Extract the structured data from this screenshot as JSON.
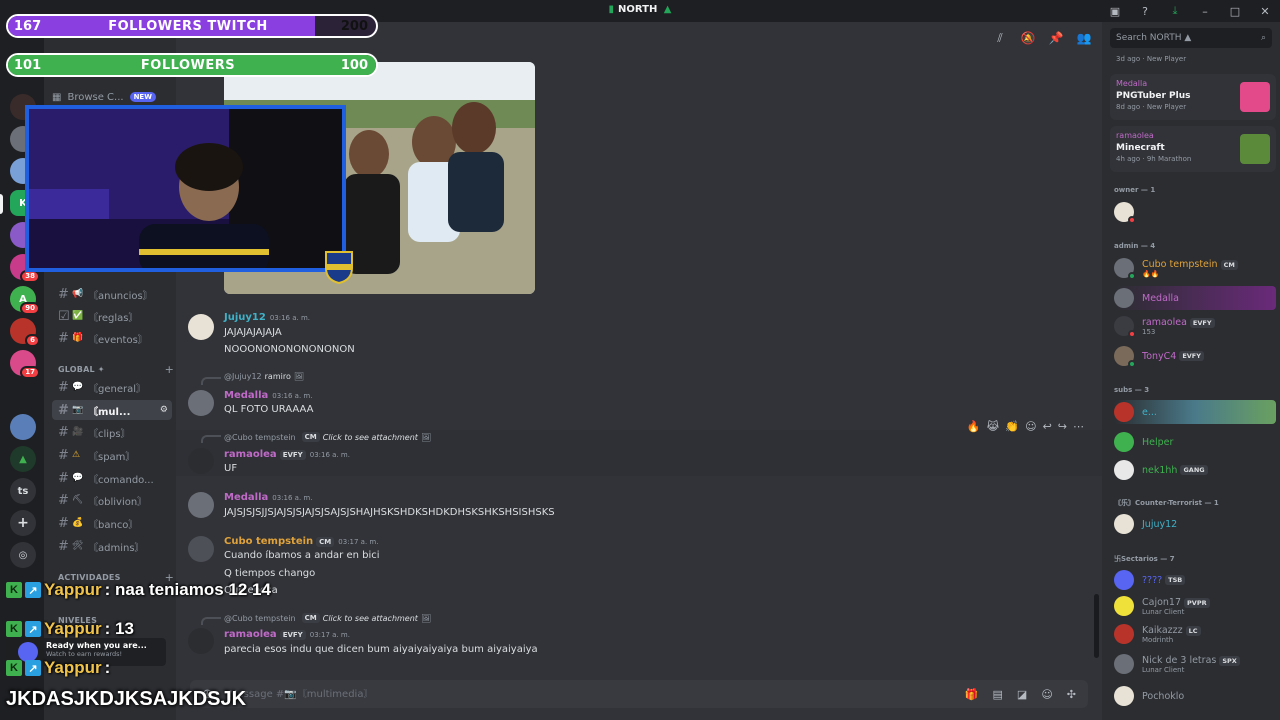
{
  "window": {
    "server_title": "NORTH",
    "server_emoji": "▲"
  },
  "overlays": {
    "twitch_bar": {
      "current": "167",
      "label": "FOLLOWERS TWITCH",
      "goal": "200",
      "progress": 0.835,
      "color": "#8a3fe0"
    },
    "followers_bar": {
      "current": "101",
      "label": "FOLLOWERS",
      "goal": "100",
      "progress": 1.0,
      "color": "#3fb24f"
    },
    "chat": [
      {
        "user": "Yappur",
        "text": ": naa teniamos 12 14"
      },
      {
        "user": "Yappur",
        "text": ": 13"
      },
      {
        "user": "Yappur",
        "text": ":"
      }
    ],
    "bottom_text": "JKDASJKDJKSAJKDSJK",
    "promo": {
      "title": "Ready when you are...",
      "subtitle": "Watch to earn rewards!"
    }
  },
  "rail": {
    "servers": [
      {
        "badge": ""
      },
      {
        "badge": ""
      },
      {
        "badge": ""
      },
      {
        "badge": ""
      },
      {
        "badge": ""
      },
      {
        "badge": ""
      },
      {
        "badge": "38"
      },
      {
        "badge": "90"
      },
      {
        "badge": "6"
      },
      {
        "badge": "17"
      },
      {
        "badge": ""
      },
      {
        "badge": ""
      }
    ],
    "ts_label": "ts"
  },
  "sidebar": {
    "browse": "Browse C...",
    "browse_badge": "NEW",
    "channels_top": [
      {
        "icon": "📢",
        "name": "〘anuncios〙"
      },
      {
        "icon": "✅",
        "name": "〘reglas〙"
      },
      {
        "icon": "🎁",
        "name": "〘eventos〙"
      }
    ],
    "category_global": "GLOBAL ✦",
    "channels_global": [
      {
        "icon": "💬",
        "name": "〘general〙",
        "active": false
      },
      {
        "icon": "📷",
        "name": "〘mul...",
        "active": true
      },
      {
        "icon": "🎥",
        "name": "〘clips〙",
        "active": false
      },
      {
        "icon": "⚠",
        "name": "〘spam〙",
        "active": false
      },
      {
        "icon": "💬",
        "name": "〘comando...",
        "active": false
      },
      {
        "icon": "⛏",
        "name": "〘oblivion〙",
        "active": false
      },
      {
        "icon": "💰",
        "name": "〘banco〙",
        "active": false
      },
      {
        "icon": "🛠",
        "name": "〘admins〙",
        "active": false
      }
    ],
    "category_actividades": "ACTIVIDADES",
    "category_niveles": "NIVELES"
  },
  "chat": {
    "messages": [
      {
        "user": "Jujuy12",
        "color": "#3fb2c8",
        "time": "03:16 a. m.",
        "lines": [
          "JAJAJAJAJAJA",
          "NOOONONONONONONON"
        ]
      },
      {
        "reply_user": "@Jujuy12",
        "reply_text": "ramiro",
        "user": "Medalla",
        "color": "#c06ac8",
        "time": "03:16 a. m.",
        "lines": [
          "QL FOTO URAAAA"
        ]
      },
      {
        "reply_user": "@Cubo tempstein",
        "reply_tag": "CM",
        "reply_text": "Click to see attachment",
        "user": "ramaolea",
        "color": "#c06ac8",
        "tag": "EVFY",
        "time": "03:16 a. m.",
        "lines": [
          "UF"
        ]
      },
      {
        "user": "Medalla",
        "color": "#c06ac8",
        "time": "03:16 a. m.",
        "lines": [
          "JAJSJSJSJJSJAJSJSJAJSJSAJSJSHAJHSKSHDKSHDKDHSKSHKSHSISHSKS"
        ]
      },
      {
        "user": "Cubo tempstein",
        "color": "#e0a23a",
        "tag": "CM",
        "time": "03:17 a. m.",
        "lines": [
          "Cuando íbamos a andar en bici",
          "Q tiempos chango",
          "Qué epoca"
        ]
      },
      {
        "reply_user": "@Cubo tempstein",
        "reply_tag": "CM",
        "reply_text": "Click to see attachment",
        "user": "ramaolea",
        "color": "#c06ac8",
        "tag": "EVFY",
        "time": "03:17 a. m.",
        "lines": [
          "parecia esos indu que dicen bum aiyaiyaiyaiya bum aiyaiyaiya"
        ]
      }
    ],
    "composer_placeholder": "Message #📷〘multimedia〙"
  },
  "members": {
    "search_placeholder": "Search NORTH ▲",
    "activity_cards": [
      {
        "user": "",
        "title": "",
        "meta": "3d ago",
        "badge": "New Player"
      },
      {
        "user": "Medalla",
        "title": "PNGTuber Plus",
        "meta": "8d ago",
        "badge": "New Player"
      },
      {
        "user": "ramaolea",
        "title": "Minecraft",
        "meta": "4h ago",
        "badge": "9h Marathon"
      }
    ],
    "groups": [
      {
        "label": "owner — 1",
        "members": [
          {
            "name": "",
            "color": "#f23f43",
            "tag": "",
            "sub": ""
          }
        ]
      },
      {
        "label": "admin — 4",
        "members": [
          {
            "name": "Cubo tempstein",
            "color": "#e0a23a",
            "tag": "CM",
            "sub": "🔥🔥"
          },
          {
            "name": "Medalla",
            "color": "#c06ac8",
            "tag": "",
            "sub": ""
          },
          {
            "name": "ramaolea",
            "color": "#c06ac8",
            "tag": "EVFY",
            "sub": "153"
          },
          {
            "name": "TonyC4",
            "color": "#c06ac8",
            "tag": "EVFY",
            "sub": ""
          }
        ]
      },
      {
        "label": "subs — 3",
        "members": [
          {
            "name": "e...",
            "color": "#3fb2c8",
            "tag": "",
            "sub": ""
          },
          {
            "name": "Helper",
            "color": "#3fb24f",
            "tag": "",
            "sub": ""
          },
          {
            "name": "nek1hh",
            "color": "#3fb24f",
            "tag": "GANG",
            "sub": ""
          }
        ]
      },
      {
        "label": "〘乐〙Counter-Terrorist — 1",
        "members": [
          {
            "name": "Jujuy12",
            "color": "#3fb2c8",
            "tag": "",
            "sub": ""
          }
        ]
      },
      {
        "label": "卐Sectarios — 7",
        "members": [
          {
            "name": "????",
            "color": "#5865f2",
            "tag": "TSB",
            "sub": ""
          },
          {
            "name": "Cajon17",
            "color": "#949ba4",
            "tag": "PVPR",
            "sub": "Lunar Client"
          },
          {
            "name": "Kaikazzz",
            "color": "#949ba4",
            "tag": "LC",
            "sub": "Modrinth"
          },
          {
            "name": "Nick de 3 letras",
            "color": "#949ba4",
            "tag": "SPX",
            "sub": "Lunar Client"
          },
          {
            "name": "Pochoklo",
            "color": "#949ba4",
            "tag": "",
            "sub": ""
          }
        ]
      }
    ]
  }
}
